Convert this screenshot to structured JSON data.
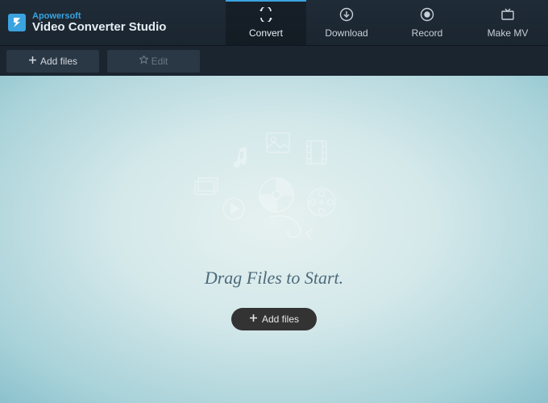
{
  "brand": {
    "company": "Apowersoft",
    "product": "Video Converter Studio"
  },
  "tabs": [
    {
      "label": "Convert",
      "active": true
    },
    {
      "label": "Download",
      "active": false
    },
    {
      "label": "Record",
      "active": false
    },
    {
      "label": "Make MV",
      "active": false
    }
  ],
  "toolbar": {
    "add_files": "Add files",
    "edit": "Edit"
  },
  "workspace": {
    "drag_text": "Drag Files to Start.",
    "add_files_btn": "Add files"
  }
}
